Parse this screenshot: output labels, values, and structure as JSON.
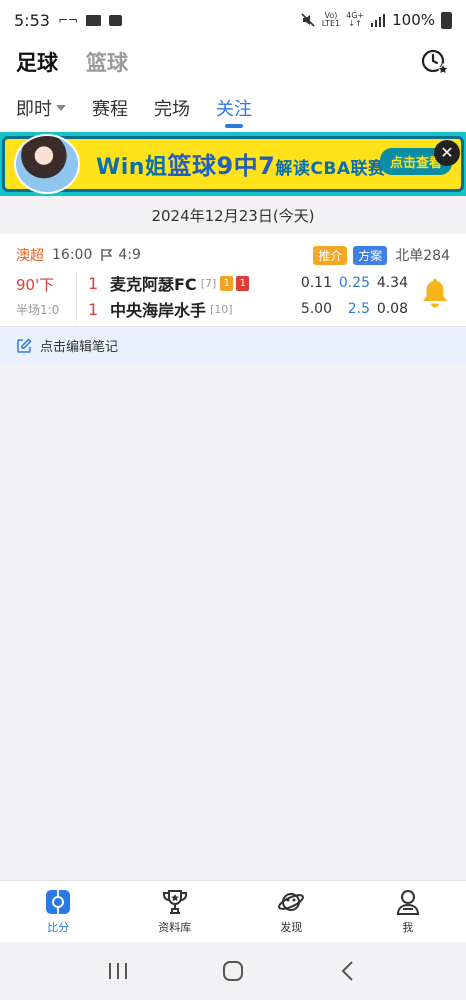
{
  "status_bar": {
    "time": "5:53",
    "lte_top": "Vo)",
    "lte_bottom": "LTE1",
    "net_top": "4G+",
    "battery": "100%"
  },
  "header": {
    "tabs": [
      "足球",
      "篮球"
    ],
    "active_tab": "足球",
    "history_icon": "clock-star-icon"
  },
  "sub_tabs": {
    "items": [
      "即时",
      "赛程",
      "完场",
      "关注"
    ],
    "active": "关注"
  },
  "banner": {
    "text_a": "Win姐",
    "text_b": "篮球9中7",
    "text_c": "解读CBA联赛",
    "cta": "点击查看",
    "close": "✕"
  },
  "date_label": "2024年12月23日(今天)",
  "match": {
    "league": "澳超",
    "time": "16:00",
    "corners": "4:9",
    "tag_recommend": "推介",
    "tag_plan": "方案",
    "beidan": "北单284",
    "minute": "90'下",
    "half_score": "半场1:0",
    "home": {
      "score": "1",
      "name": "麦克阿瑟FC",
      "rank": "[7]",
      "yellow": "1",
      "red": "1",
      "odds": [
        "0.11",
        "0.25",
        "4.34"
      ]
    },
    "away": {
      "score": "1",
      "name": "中央海岸水手",
      "rank": "[10]",
      "odds": [
        "5.00",
        "2.5",
        "0.08"
      ]
    }
  },
  "note": {
    "label": "点击编辑笔记"
  },
  "bottom_nav": {
    "items": [
      {
        "label": "比分",
        "icon": "scoreboard-icon"
      },
      {
        "label": "资料库",
        "icon": "trophy-icon"
      },
      {
        "label": "发现",
        "icon": "planet-icon"
      },
      {
        "label": "我",
        "icon": "user-icon"
      }
    ]
  },
  "colors": {
    "accent": "#2a7ae4",
    "league": "#e0642a",
    "score_red": "#e23b35",
    "bell": "#f6b619"
  }
}
